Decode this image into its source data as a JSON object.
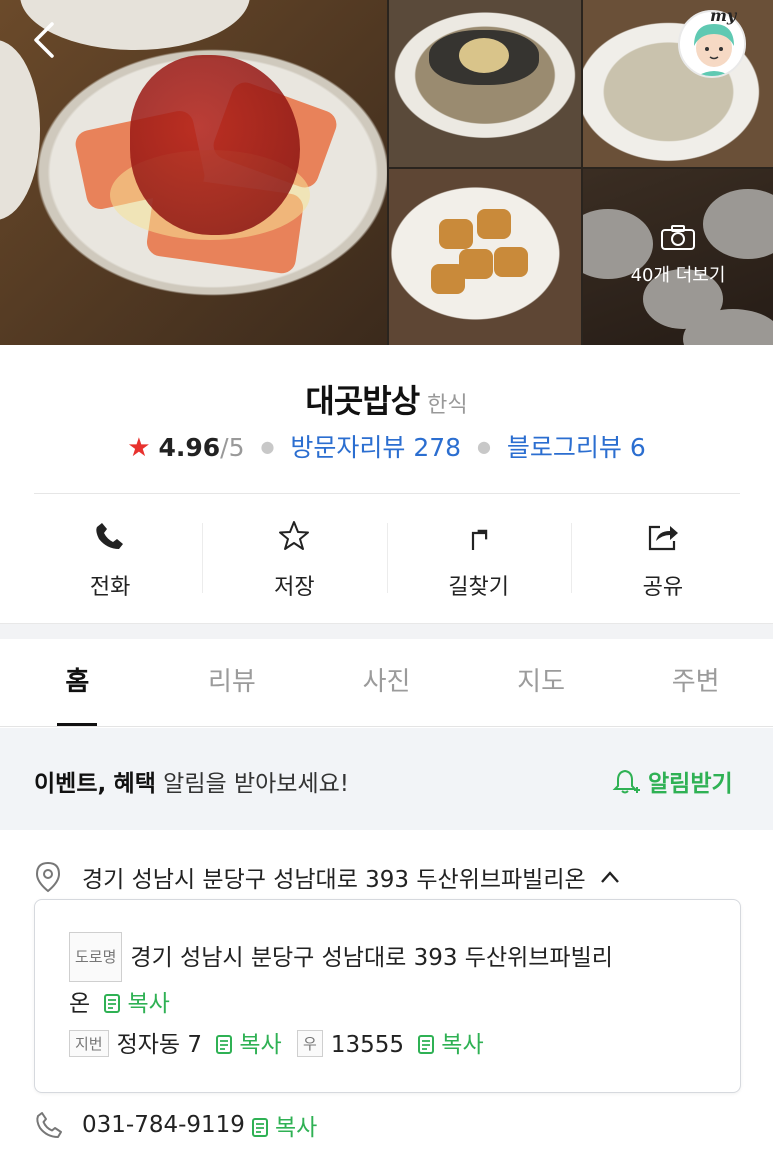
{
  "gallery": {
    "more_label": "40개 더보기",
    "my_label": "my"
  },
  "place": {
    "name": "대곳밥상",
    "category": "한식",
    "rating": "4.96",
    "rating_max": "/5",
    "visitor_reviews_label": "방문자리뷰",
    "visitor_reviews_count": "278",
    "blog_reviews_label": "블로그리뷰",
    "blog_reviews_count": "6"
  },
  "actions": [
    {
      "label": "전화",
      "icon": "phone-icon"
    },
    {
      "label": "저장",
      "icon": "star-icon"
    },
    {
      "label": "길찾기",
      "icon": "directions-icon"
    },
    {
      "label": "공유",
      "icon": "share-icon"
    }
  ],
  "tabs": [
    "홈",
    "리뷰",
    "사진",
    "지도",
    "주변"
  ],
  "notice": {
    "bold1": "이벤트,",
    "bold2": "혜택",
    "text": "알림을 받아보세요!",
    "button": "알림받기"
  },
  "address": {
    "summary": "경기 성남시 분당구 성남대로 393 두산위브파빌리온",
    "road_tag": "도로명",
    "road_line1": "경기 성남시 분당구 성남대로 393 두산위브파빌리",
    "road_line2": "온",
    "lot_tag": "지번",
    "lot": "정자동 7",
    "zip_tag": "우",
    "zip": "13555",
    "copy_label": "복사"
  },
  "phone": {
    "number": "031-784-9119",
    "copy_label": "복사"
  },
  "colors": {
    "accent_green": "#2fb154",
    "link_blue": "#2b6ed0",
    "star_red": "#e8322e"
  }
}
